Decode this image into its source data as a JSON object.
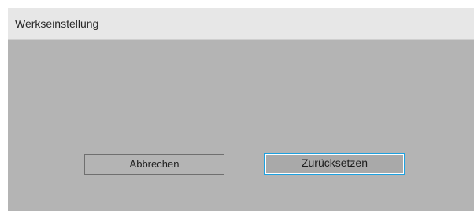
{
  "dialog": {
    "title": "Werkseinstellung",
    "buttons": {
      "cancel_label": "Abbrechen",
      "reset_label": "Zurücksetzen"
    },
    "focused_button": "reset"
  },
  "colors": {
    "panel_background": "#b4b4b4",
    "title_bar_background": "#e7e7e7",
    "focus_accent": "#1da1e0"
  }
}
